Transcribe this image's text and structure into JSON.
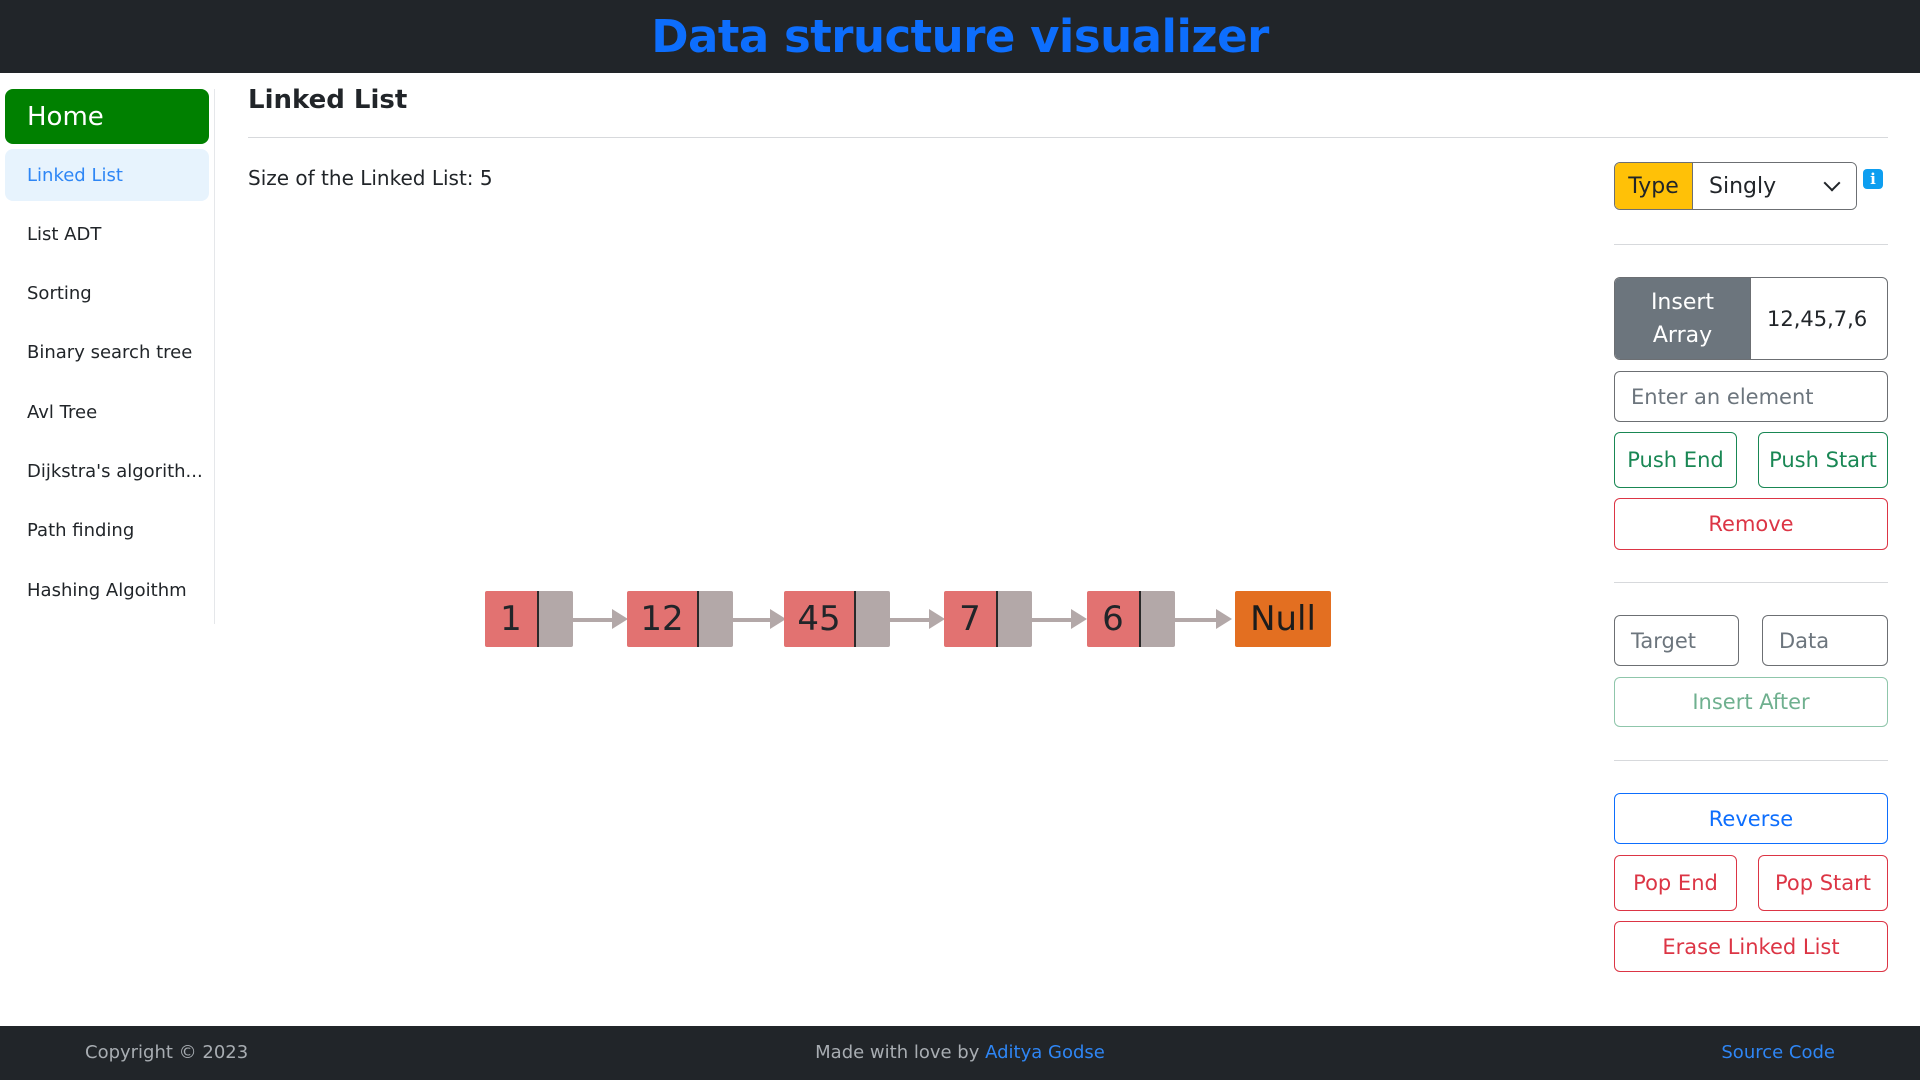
{
  "header": {
    "title": "Data structure visualizer"
  },
  "sidebar": {
    "home": "Home",
    "items": [
      {
        "label": "Linked List",
        "active": true
      },
      {
        "label": "List ADT"
      },
      {
        "label": "Sorting"
      },
      {
        "label": "Binary search tree"
      },
      {
        "label": "Avl Tree"
      },
      {
        "label": "Dijkstra's algorith..."
      },
      {
        "label": "Path finding"
      },
      {
        "label": "Hashing Algoithm"
      }
    ]
  },
  "main": {
    "title": "Linked List",
    "size_text": "Size of the Linked List: 5",
    "linked_list": {
      "nodes": [
        "1",
        "12",
        "45",
        "7",
        "6"
      ],
      "null_label": "Null"
    }
  },
  "controls": {
    "type_label": "Type",
    "type_value": "Singly",
    "info_glyph": "i",
    "insert_array_label": "Insert Array",
    "insert_array_value": "12,45,7,6",
    "element_placeholder": "Enter an element",
    "push_end": "Push End",
    "push_start": "Push Start",
    "remove": "Remove",
    "target_placeholder": "Target",
    "data_placeholder": "Data",
    "insert_after": "Insert After",
    "reverse": "Reverse",
    "pop_end": "Pop End",
    "pop_start": "Pop Start",
    "erase": "Erase Linked List"
  },
  "footer": {
    "copyright": "Copyright © 2023",
    "made_with": "Made with love by ",
    "author": "Aditya Godse",
    "source": "Source Code"
  },
  "colors": {
    "brand": "#0d6efd",
    "home": "#008000",
    "node": "#e27271",
    "pointer": "#b3a8a8",
    "null": "#e36f21",
    "type_label": "#ffc107"
  }
}
